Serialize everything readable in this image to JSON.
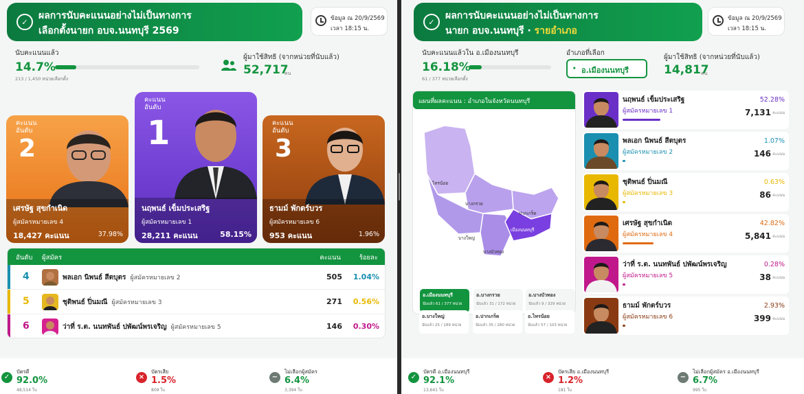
{
  "left": {
    "header": {
      "title1": "ผลการนับคะแนนอย่างไม่เป็นทางการ",
      "title2": "เลือกตั้งนายก อบจ.นนทบุรี 2569"
    },
    "update": {
      "line1": "ข้อมูล ณ 20/9/2569",
      "line2": "เวลา 18:15 น."
    },
    "counted": {
      "label": "นับคะแนนแล้ว",
      "pct": "14.7%",
      "progress": 0.147,
      "sub": "213 / 1,450 หน่วยเลือกตั้ง"
    },
    "voters": {
      "label": "ผู้มาใช้สิทธิ (จากหน่วยที่นับแล้ว)",
      "value": "52,717",
      "unit": "คน"
    },
    "cards": [
      {
        "rank_label": "คะแนน\nอันดับ",
        "rank": "2",
        "name": "เศรษัฐ สุขกำเนิด",
        "number": "ผู้สมัครหมายเลข 4",
        "votes": "18,427 คะแนน",
        "pct": "37.98%"
      },
      {
        "rank_label": "คะแนน\nอันดับ",
        "rank": "1",
        "name": "นฤพนธ์ เข็มประเสริฐ",
        "number": "ผู้สมัครหมายเลข 1",
        "votes": "28,211 คะแนน",
        "pct": "58.15%"
      },
      {
        "rank_label": "คะแนน\nอันดับ",
        "rank": "3",
        "name": "ธามม์ พักตร์บวร",
        "number": "ผู้สมัครหมายเลข 6",
        "votes": "953 คะแนน",
        "pct": "1.96%"
      }
    ],
    "table": {
      "headers": {
        "rank": "อันดับ",
        "candidate": "ผู้สมัคร",
        "votes": "คะแนน",
        "pct": "ร้อยละ"
      },
      "rows": [
        {
          "rank": "4",
          "name": "พลเอก นิพนธ์ สีตบุตร",
          "number": "ผู้สมัครหมายเลข 2",
          "votes": "505",
          "pct": "1.04%",
          "color": "#1a8fb0"
        },
        {
          "rank": "5",
          "name": "ชุติพนธ์ ปิ่นมณี",
          "number": "ผู้สมัครหมายเลข 3",
          "votes": "271",
          "pct": "0.56%",
          "color": "#e8b800"
        },
        {
          "rank": "6",
          "name": "ว่าที่ ร.ต. นนทพันธ์ ปพัฒน์พรเจริญ",
          "number": "ผู้สมัครหมายเลข 5",
          "votes": "146",
          "pct": "0.30%",
          "color": "#c0188a"
        }
      ]
    },
    "footer": [
      {
        "label": "บัตรดี",
        "value": "92.0%",
        "sub": "48,514 ใบ"
      },
      {
        "label": "บัตรเสีย",
        "value": "1.5%",
        "sub": "809 ใบ"
      },
      {
        "label": "ไม่เลือกผู้สมัคร",
        "value": "6.4%",
        "sub": "3,394 ใบ"
      }
    ]
  },
  "right": {
    "header": {
      "title1": "ผลการนับคะแนนอย่างไม่เป็นทางการ",
      "title2": "นายก อบจ.นนทบุรี · ",
      "title2_accent": "รายอำเภอ"
    },
    "update": {
      "line1": "ข้อมูล ณ 20/9/2569",
      "line2": "เวลา 18:15 น."
    },
    "counted": {
      "label": "นับคะแนนแล้วใน อ.เมืองนนทบุรี",
      "pct": "16.18%",
      "progress": 0.1618,
      "sub": "61 / 377 หน่วยเลือกตั้ง"
    },
    "district_select": {
      "label": "อำเภอที่เลือก",
      "value": "อ.เมืองนนทบุรี"
    },
    "voters": {
      "label": "ผู้มาใช้สิทธิ (จากหน่วยที่นับแล้ว)",
      "value": "14,817",
      "unit": "คน"
    },
    "map": {
      "title": "แผนที่ผลคะแนน : อำเภอในจังหวัดนนทบุรี",
      "labels": [
        "ไทรน้อย",
        "บางบัวทอง",
        "บางใหญ่",
        "บางกรวย",
        "ปากเกร็ด",
        "เมืองนนทบุรี"
      ],
      "districts": [
        {
          "name": "อ.เมืองนนทบุรี",
          "sub": "นับแล้ว 61 / 377 หน่วย"
        },
        {
          "name": "อ.บางกรวย",
          "sub": "นับแล้ว 31 / 172 หน่วย"
        },
        {
          "name": "อ.บางบัวทอง",
          "sub": "นับแล้ว 9 / 329 หน่วย"
        },
        {
          "name": "อ.บางใหญ่",
          "sub": "นับแล้ว 25 / 189 หน่วย"
        },
        {
          "name": "อ.ปากเกร็ด",
          "sub": "นับแล้ว 35 / 280 หน่วย"
        },
        {
          "name": "อ.ไทรน้อย",
          "sub": "นับแล้ว 57 / 103 หน่วย"
        }
      ]
    },
    "results": [
      {
        "name": "นฤพนธ์ เข็มประเสริฐ",
        "number": "ผู้สมัครหมายเลข 1",
        "pct": "52.28%",
        "votes": "7,131",
        "unit": "คะแนน",
        "color": "#6a2fc7",
        "frac": 0.5228
      },
      {
        "name": "พลเอก นิพนธ์ สีตบุตร",
        "number": "ผู้สมัครหมายเลข 2",
        "pct": "1.07%",
        "votes": "146",
        "unit": "คะแนน",
        "color": "#1a8fb0",
        "frac": 0.0107
      },
      {
        "name": "ชุติพนธ์ ปิ่นมณี",
        "number": "ผู้สมัครหมายเลข 3",
        "pct": "0.63%",
        "votes": "86",
        "unit": "คะแนน",
        "color": "#e8b800",
        "frac": 0.0063
      },
      {
        "name": "เศรษัฐ สุขกำเนิด",
        "number": "ผู้สมัครหมายเลข 4",
        "pct": "42.82%",
        "votes": "5,841",
        "unit": "คะแนน",
        "color": "#e06a10",
        "frac": 0.4282
      },
      {
        "name": "ว่าที่ ร.ต. นนทพันธ์ ปพัฒน์พรเจริญ",
        "number": "ผู้สมัครหมายเลข 5",
        "pct": "0.28%",
        "votes": "38",
        "unit": "คะแนน",
        "color": "#c0188a",
        "frac": 0.0028
      },
      {
        "name": "ธามม์ พักตร์บวร",
        "number": "ผู้สมัครหมายเลข 6",
        "pct": "2.93%",
        "votes": "399",
        "unit": "คะแนน",
        "color": "#8a3a12",
        "frac": 0.0293
      }
    ],
    "footer": [
      {
        "label": "บัตรดี อ.เมืองนนทบุรี",
        "value": "92.1%",
        "sub": "13,641 ใบ"
      },
      {
        "label": "บัตรเสีย อ.เมืองนนทบุรี",
        "value": "1.2%",
        "sub": "181 ใบ"
      },
      {
        "label": "ไม่เลือกผู้สมัคร อ.เมืองนนทบุรี",
        "value": "6.7%",
        "sub": "995 ใบ"
      }
    ]
  }
}
